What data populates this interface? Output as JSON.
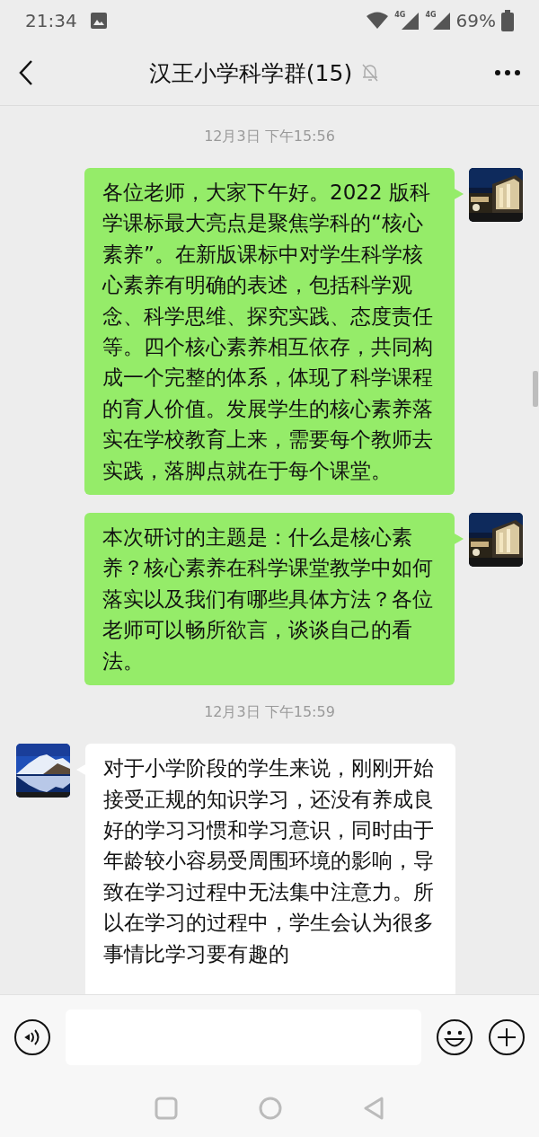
{
  "status_bar": {
    "time": "21:34",
    "battery": "69%",
    "network_1": "4G",
    "network_2": "4G"
  },
  "header": {
    "title": "汉王小学科学群(15)",
    "muted": true
  },
  "messages": [
    {
      "kind": "time",
      "text": "12月3日 下午15:56"
    },
    {
      "kind": "sent",
      "text": "各位老师，大家下午好。2022 版科学课标最大亮点是聚焦学科的“核心素养”。在新版课标中对学生科学核心素养有明确的表述，包括科学观念、科学思维、探究实践、态度责任等。四个核心素养相互依存，共同构成一个完整的体系，体现了科学课程的育人价值。发展学生的核心素养落实在学校教育上来，需要每个教师去实践，落脚点就在于每个课堂。"
    },
    {
      "kind": "sent",
      "text": "本次研讨的主题是：什么是核心素养？核心素养在科学课堂教学中如何落实以及我们有哪些具体方法？各位老师可以畅所欲言，谈谈自己的看法。"
    },
    {
      "kind": "time",
      "text": "12月3日 下午15:59"
    },
    {
      "kind": "received",
      "text": "对于小学阶段的学生来说，刚刚开始接受正规的知识学习，还没有养成良好的学习习惯和学习意识，同时由于年龄较小容易受周围环境的影响，导致在学习过程中无法集中注意力。所以在学习的过程中，学生会认为很多事情比学习要有趣的"
    }
  ]
}
